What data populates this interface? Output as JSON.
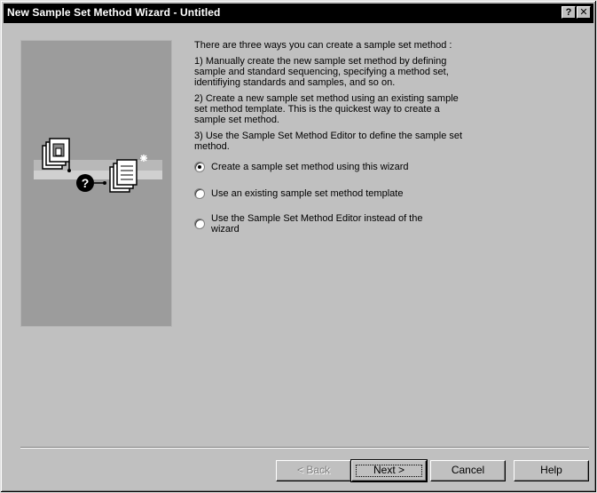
{
  "window": {
    "title": "New Sample Set Method Wizard - Untitled",
    "help_button": "?",
    "close_button": "✕"
  },
  "content": {
    "intro": "There are three ways you can create a sample set method :",
    "option1_desc": "1) Manually create the new sample set method by defining sample and standard sequencing, specifying a method set, identifiying standards and samples, and so on.",
    "option2_desc": "2) Create a new sample set method using an existing sample set method template. This is the quickest way to create a sample set method.",
    "option3_desc": "3) Use the Sample Set Method Editor to define the sample set method."
  },
  "radios": [
    {
      "label": "Create a sample set method using this wizard",
      "checked": true
    },
    {
      "label": "Use an existing sample set method template",
      "checked": false
    },
    {
      "label": "Use the Sample Set Method Editor instead of the wizard",
      "checked": false
    }
  ],
  "buttons": {
    "back": "< Back",
    "next": "Next >",
    "cancel": "Cancel",
    "help": "Help"
  },
  "icons": {
    "illustration": "document-question-document-icon"
  }
}
